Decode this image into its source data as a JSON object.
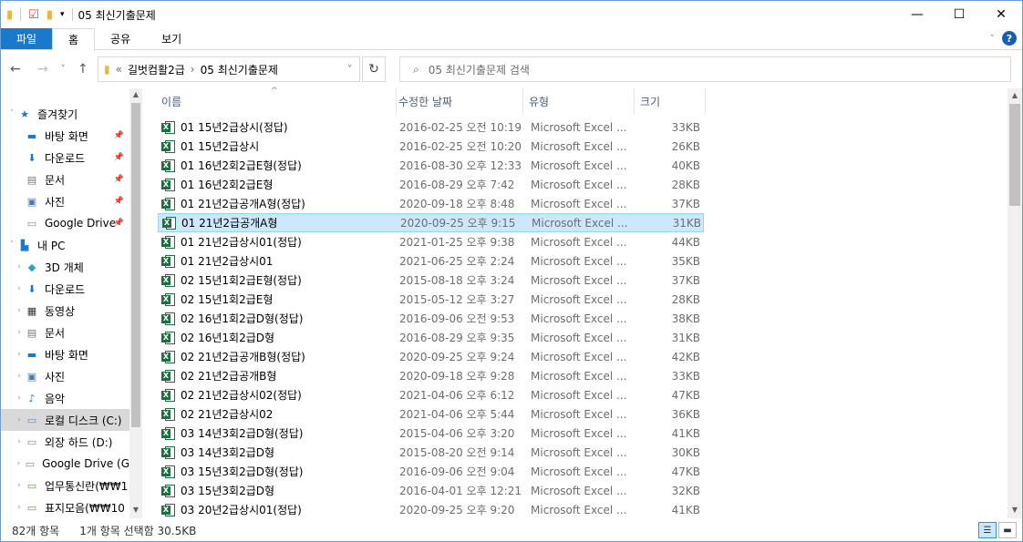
{
  "window": {
    "title": "05 최신기출문제",
    "controls": {
      "minimize": "—",
      "maximize": "☐",
      "close": "✕"
    }
  },
  "ribbon": {
    "tabs": [
      "파일",
      "홈",
      "공유",
      "보기"
    ],
    "help": "?"
  },
  "address": {
    "overflow": "«",
    "crumbs": [
      "길벗컴활2급",
      "05 최신기출문제"
    ],
    "separator": "›",
    "search_placeholder": "05 최신기출문제 검색"
  },
  "nav": {
    "items": [
      {
        "label": "즐겨찾기",
        "icon": "star-icon",
        "glyph": "★",
        "color": "#1979ca",
        "level": 0,
        "chev": "˅",
        "pinned": false
      },
      {
        "label": "바탕 화면",
        "icon": "desktop-icon",
        "glyph": "▬",
        "color": "#1979ca",
        "level": 1,
        "chev": "",
        "pinned": true
      },
      {
        "label": "다운로드",
        "icon": "download-icon",
        "glyph": "⬇",
        "color": "#1979ca",
        "level": 1,
        "chev": "",
        "pinned": true
      },
      {
        "label": "문서",
        "icon": "document-icon",
        "glyph": "▤",
        "color": "#777777",
        "level": 1,
        "chev": "",
        "pinned": true
      },
      {
        "label": "사진",
        "icon": "picture-icon",
        "glyph": "▣",
        "color": "#4a7ab0",
        "level": 1,
        "chev": "",
        "pinned": true
      },
      {
        "label": "Google Drive",
        "icon": "drive-icon",
        "glyph": "▭",
        "color": "#888888",
        "level": 1,
        "chev": "",
        "pinned": true
      },
      {
        "label": "내 PC",
        "icon": "pc-icon",
        "glyph": "▙",
        "color": "#1979ca",
        "level": 0,
        "chev": "˅",
        "pinned": false
      },
      {
        "label": "3D 개체",
        "icon": "3d-objects-icon",
        "glyph": "◆",
        "color": "#26a0da",
        "level": 1,
        "chev": "›",
        "pinned": false
      },
      {
        "label": "다운로드",
        "icon": "download-icon",
        "glyph": "⬇",
        "color": "#1979ca",
        "level": 1,
        "chev": "›",
        "pinned": false
      },
      {
        "label": "동영상",
        "icon": "video-icon",
        "glyph": "▦",
        "color": "#333333",
        "level": 1,
        "chev": "›",
        "pinned": false
      },
      {
        "label": "문서",
        "icon": "document-icon",
        "glyph": "▤",
        "color": "#777777",
        "level": 1,
        "chev": "›",
        "pinned": false
      },
      {
        "label": "바탕 화면",
        "icon": "desktop-icon",
        "glyph": "▬",
        "color": "#1979ca",
        "level": 1,
        "chev": "›",
        "pinned": false
      },
      {
        "label": "사진",
        "icon": "picture-icon",
        "glyph": "▣",
        "color": "#4a7ab0",
        "level": 1,
        "chev": "›",
        "pinned": false
      },
      {
        "label": "음악",
        "icon": "music-icon",
        "glyph": "♪",
        "color": "#1979ca",
        "level": 1,
        "chev": "›",
        "pinned": false
      },
      {
        "label": "로컬 디스크 (C:)",
        "icon": "disk-icon",
        "glyph": "▭",
        "color": "#5a8ed0",
        "level": 1,
        "chev": "›",
        "pinned": false
      },
      {
        "label": "외장 하드 (D:)",
        "icon": "disk-icon",
        "glyph": "▭",
        "color": "#888888",
        "level": 1,
        "chev": "›",
        "pinned": false
      },
      {
        "label": "Google Drive (G",
        "icon": "drive-icon",
        "glyph": "▭",
        "color": "#888888",
        "level": 1,
        "chev": "›",
        "pinned": false
      },
      {
        "label": "업무통신란(₩₩1",
        "icon": "network-drive-icon",
        "glyph": "▭",
        "color": "#5a9c4a",
        "level": 1,
        "chev": "›",
        "pinned": false
      },
      {
        "label": "표지모음(₩₩10",
        "icon": "network-drive-icon",
        "glyph": "▭",
        "color": "#5a9c4a",
        "level": 1,
        "chev": "›",
        "pinned": false
      }
    ],
    "selected_index": 14
  },
  "columns": {
    "name": "이름",
    "date": "수정한 날짜",
    "type": "유형",
    "size": "크기"
  },
  "files": [
    {
      "name": "01 15년2급상시(정답)",
      "date": "2016-02-25 오전 10:19",
      "type": "Microsoft Excel ...",
      "size": "33KB"
    },
    {
      "name": "01 15년2급상시",
      "date": "2016-02-25 오전 10:20",
      "type": "Microsoft Excel ...",
      "size": "26KB"
    },
    {
      "name": "01 16년2회2급E형(정답)",
      "date": "2016-08-30 오후 12:33",
      "type": "Microsoft Excel ...",
      "size": "40KB"
    },
    {
      "name": "01 16년2회2급E형",
      "date": "2016-08-29 오후 7:42",
      "type": "Microsoft Excel ...",
      "size": "28KB"
    },
    {
      "name": "01 21년2급공개A형(정답)",
      "date": "2020-09-18 오후 8:48",
      "type": "Microsoft Excel ...",
      "size": "37KB"
    },
    {
      "name": "01 21년2급공개A형",
      "date": "2020-09-25 오후 9:15",
      "type": "Microsoft Excel ...",
      "size": "31KB"
    },
    {
      "name": "01 21년2급상시01(정답)",
      "date": "2021-01-25 오후 9:38",
      "type": "Microsoft Excel ...",
      "size": "44KB"
    },
    {
      "name": "01 21년2급상시01",
      "date": "2021-06-25 오후 2:24",
      "type": "Microsoft Excel ...",
      "size": "35KB"
    },
    {
      "name": "02 15년1회2급E형(정답)",
      "date": "2015-08-18 오후 3:24",
      "type": "Microsoft Excel ...",
      "size": "37KB"
    },
    {
      "name": "02 15년1회2급E형",
      "date": "2015-05-12 오후 3:27",
      "type": "Microsoft Excel ...",
      "size": "28KB"
    },
    {
      "name": "02 16년1회2급D형(정답)",
      "date": "2016-09-06 오전 9:53",
      "type": "Microsoft Excel ...",
      "size": "38KB"
    },
    {
      "name": "02 16년1회2급D형",
      "date": "2016-08-29 오후 9:35",
      "type": "Microsoft Excel ...",
      "size": "31KB"
    },
    {
      "name": "02 21년2급공개B형(정답)",
      "date": "2020-09-25 오후 9:24",
      "type": "Microsoft Excel ...",
      "size": "42KB"
    },
    {
      "name": "02 21년2급공개B형",
      "date": "2020-09-18 오후 9:28",
      "type": "Microsoft Excel ...",
      "size": "33KB"
    },
    {
      "name": "02 21년2급상시02(정답)",
      "date": "2021-04-06 오후 6:12",
      "type": "Microsoft Excel ...",
      "size": "47KB"
    },
    {
      "name": "02 21년2급상시02",
      "date": "2021-04-06 오후 5:44",
      "type": "Microsoft Excel ...",
      "size": "36KB"
    },
    {
      "name": "03 14년3회2급D형(정답)",
      "date": "2015-04-06 오후 3:20",
      "type": "Microsoft Excel ...",
      "size": "41KB"
    },
    {
      "name": "03 14년3회2급D형",
      "date": "2015-08-20 오전 9:14",
      "type": "Microsoft Excel ...",
      "size": "30KB"
    },
    {
      "name": "03 15년3회2급D형(정답)",
      "date": "2016-09-06 오전 9:04",
      "type": "Microsoft Excel ...",
      "size": "47KB"
    },
    {
      "name": "03 15년3회2급D형",
      "date": "2016-04-01 오후 12:21",
      "type": "Microsoft Excel ...",
      "size": "32KB"
    },
    {
      "name": "03 20년2급상시01(정답)",
      "date": "2020-09-25 오후 9:20",
      "type": "Microsoft Excel ...",
      "size": "41KB"
    }
  ],
  "selected_file_index": 5,
  "status": {
    "count": "82개 항목",
    "selection": "1개 항목 선택함 30.5KB"
  }
}
